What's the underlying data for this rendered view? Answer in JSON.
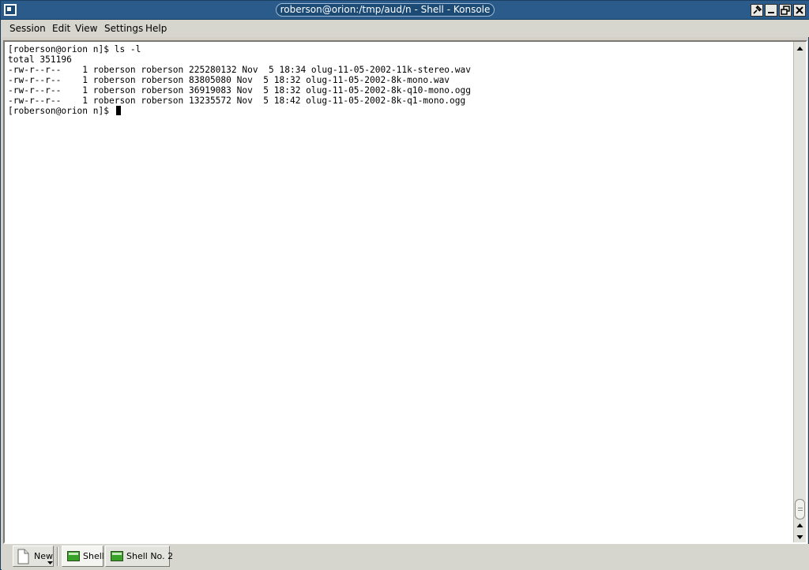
{
  "window": {
    "title": "roberson@orion:/tmp/aud/n - Shell - Konsole",
    "buttons": [
      "pin-icon",
      "minimize-icon",
      "maximize-icon",
      "close-icon"
    ]
  },
  "menubar": {
    "items": [
      "Session",
      "Edit",
      "View",
      "Settings",
      "Help"
    ]
  },
  "terminal": {
    "lines": [
      "[roberson@orion n]$ ls -l",
      "total 351196",
      "-rw-r--r--    1 roberson roberson 225280132 Nov  5 18:34 olug-11-05-2002-11k-stereo.wav",
      "-rw-r--r--    1 roberson roberson 83805080 Nov  5 18:32 olug-11-05-2002-8k-mono.wav",
      "-rw-r--r--    1 roberson roberson 36919083 Nov  5 18:32 olug-11-05-2002-8k-q10-mono.ogg",
      "-rw-r--r--    1 roberson roberson 13235572 Nov  5 18:42 olug-11-05-2002-8k-q1-mono.ogg"
    ],
    "prompt": "[roberson@orion n]$ "
  },
  "tabbar": {
    "new_label": "New",
    "tabs": [
      "Shell",
      "Shell No. 2"
    ]
  },
  "colors": {
    "titlebar": "#2a5b8a",
    "terminal_bg": "#ffffff",
    "terminal_fg": "#000000"
  }
}
